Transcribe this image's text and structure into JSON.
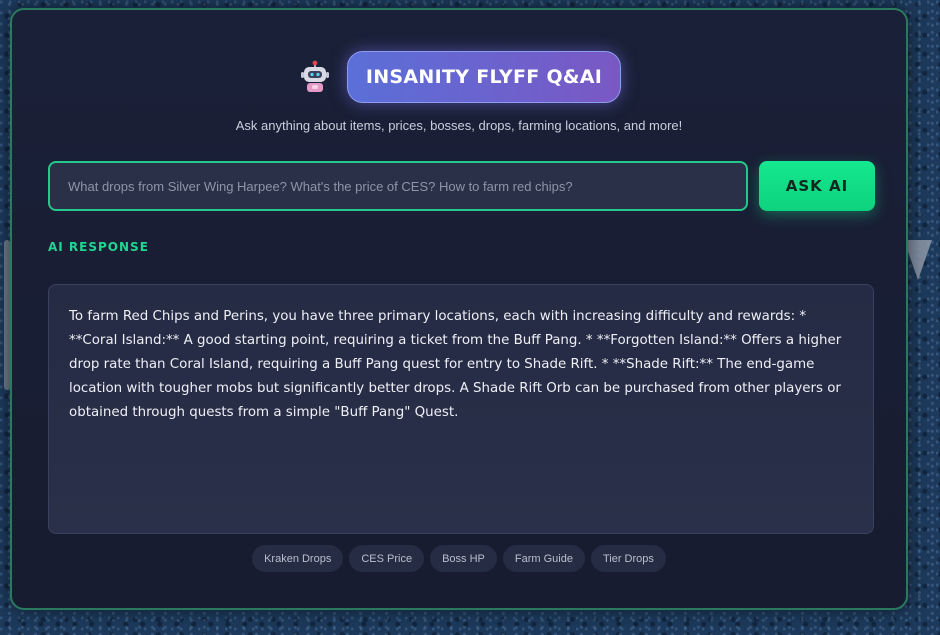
{
  "header": {
    "title": "INSANITY FLYFF Q&AI",
    "icon": "robot-icon",
    "subtitle": "Ask anything about items, prices, bosses, drops, farming locations, and more!"
  },
  "search": {
    "value": "",
    "placeholder": "What drops from Silver Wing Harpee? What's the price of CES? How to farm red chips?",
    "button_label": "ASK AI"
  },
  "response": {
    "label": "AI RESPONSE",
    "text": "To farm Red Chips and Perins, you have three primary locations, each with increasing difficulty and rewards: * **Coral Island:** A good starting point, requiring a ticket from the Buff Pang. * **Forgotten Island:** Offers a higher drop rate than Coral Island, requiring a Buff Pang quest for entry to Shade Rift. * **Shade Rift:** The end-game location with tougher mobs but significantly better drops. A Shade Rift Orb can be purchased from other players or obtained through quests from a simple \"Buff Pang\" Quest."
  },
  "quick_chips": [
    {
      "label": "Kraken Drops"
    },
    {
      "label": "CES Price"
    },
    {
      "label": "Boss HP"
    },
    {
      "label": "Farm Guide"
    },
    {
      "label": "Tier Drops"
    }
  ],
  "colors": {
    "accent_green": "#14e88f",
    "title_gradient_start": "#5b6fd8",
    "title_gradient_end": "#7a58c4",
    "panel_bg": "#1a2038",
    "panel_border": "#2a7a5e"
  }
}
